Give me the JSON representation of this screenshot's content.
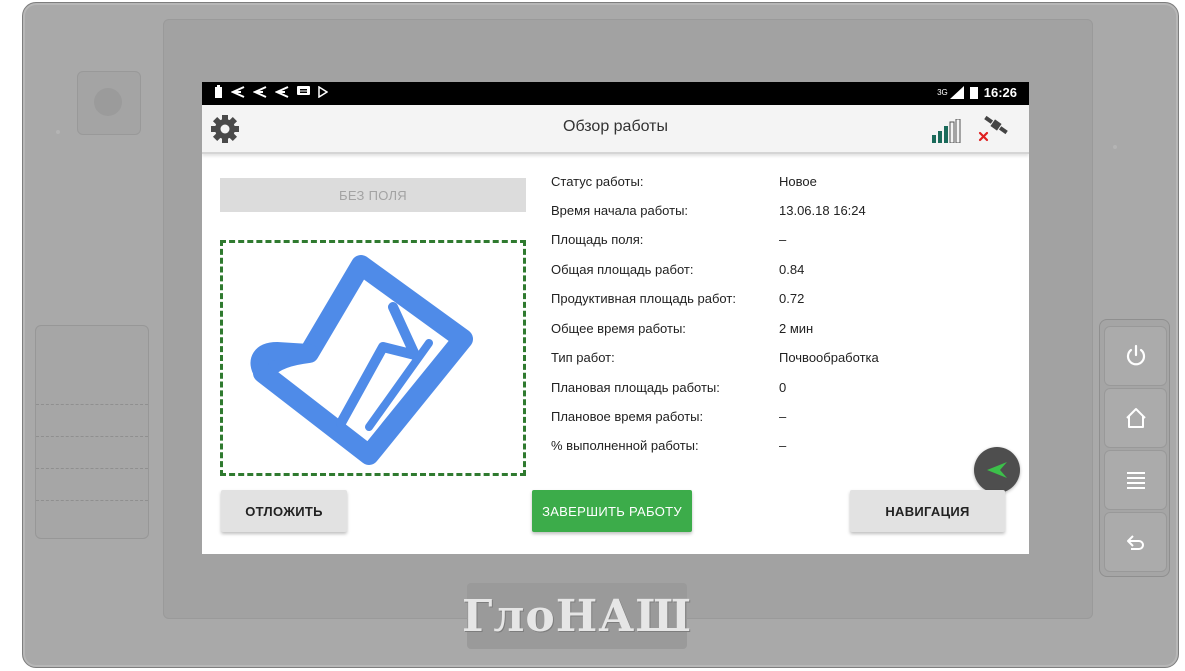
{
  "device": {
    "brand": "ГлоНАШ",
    "hardware_buttons": [
      {
        "name": "power",
        "icon": "power-icon"
      },
      {
        "name": "home",
        "icon": "home-icon"
      },
      {
        "name": "menu",
        "icon": "menu-icon"
      },
      {
        "name": "back",
        "icon": "back-icon"
      }
    ]
  },
  "statusbar": {
    "network": "3G",
    "time": "16:26",
    "left_icons": [
      "battery-icon",
      "share-icon",
      "share-icon",
      "share-icon",
      "message-icon",
      "play-icon"
    ]
  },
  "appbar": {
    "title": "Обзор работы",
    "settings_icon": "gear-icon",
    "signal_icon": "signal-bars-icon",
    "gnss_icon": "satellite-off-icon"
  },
  "field": {
    "no_field_label": "БЕЗ ПОЛЯ",
    "map_icon": "map-icon",
    "border_color": "#2f7a2f",
    "icon_color": "#4f8be8"
  },
  "work_info": [
    {
      "label": "Статус работы:",
      "value": "Новое"
    },
    {
      "label": "Время начала работы:",
      "value": "13.06.18 16:24"
    },
    {
      "label": "Площадь поля:",
      "value": "–"
    },
    {
      "label": "Общая площадь работ:",
      "value": "0.84"
    },
    {
      "label": "Продуктивная площадь работ:",
      "value": "0.72"
    },
    {
      "label": "Общее время работы:",
      "value": "2 мин"
    },
    {
      "label": "Тип работ:",
      "value": "Почвообработка"
    },
    {
      "label": "Плановая площадь работы:",
      "value": "0"
    },
    {
      "label": "Плановое время работы:",
      "value": "–"
    },
    {
      "label": "% выполненной работы:",
      "value": "–"
    }
  ],
  "fab": {
    "icon": "navigation-arrow-icon"
  },
  "actions": {
    "postpone": "ОТЛОЖИТЬ",
    "finish": "ЗАВЕРШИТЬ РАБОТУ",
    "navigation": "НАВИГАЦИЯ"
  },
  "colors": {
    "finish_button": "#3cac4a",
    "fab": "#4e4e4e",
    "fab_arrow": "#3cc04a",
    "device_body": "#a9a9a9"
  }
}
